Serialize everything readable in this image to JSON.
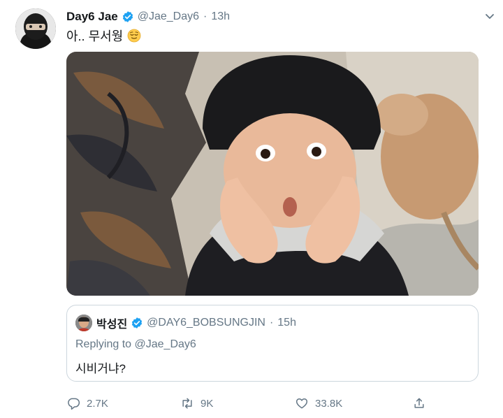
{
  "tweet": {
    "author": {
      "display_name": "Day6 Jae",
      "handle": "@Jae_Day6"
    },
    "separator": "·",
    "time": "13h",
    "text": "아.. 무서웡",
    "emoji": "relieved-face-icon"
  },
  "quote": {
    "author": {
      "display_name": "박성진",
      "handle": "@DAY6_BOBSUNGJIN"
    },
    "separator": "·",
    "time": "15h",
    "replying_prefix": "Replying to",
    "replying_to": "@Jae_Day6",
    "text": "시비거냐?"
  },
  "actions": {
    "reply_count": "2.7K",
    "retweet_count": "9K",
    "like_count": "33.8K"
  },
  "colors": {
    "verified": "#1da1f2",
    "secondary_text": "#657786",
    "border": "#ccd6dd"
  }
}
